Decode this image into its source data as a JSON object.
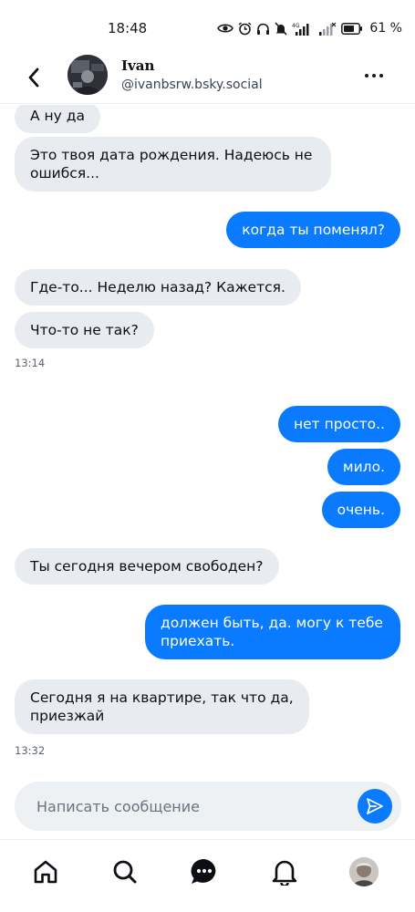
{
  "status_bar": {
    "time": "18:48",
    "network": "4G",
    "battery": "61 %"
  },
  "header": {
    "name": "Ivan",
    "handle": "@ivanbsrw.bsky.social"
  },
  "messages": [
    {
      "direction": "in",
      "text": "А ну да"
    },
    {
      "direction": "in",
      "text": "Это твоя дата рождения. Надеюсь не ошибся..."
    },
    {
      "direction": "out",
      "text": "когда ты поменял?"
    },
    {
      "direction": "in",
      "text": "Где-то... Неделю назад? Кажется."
    },
    {
      "direction": "in",
      "text": "Что-то не так?"
    },
    {
      "direction": "out",
      "text": "нет просто.."
    },
    {
      "direction": "out",
      "text": "мило."
    },
    {
      "direction": "out",
      "text": "очень."
    },
    {
      "direction": "in",
      "text": "Ты сегодня вечером свободен?"
    },
    {
      "direction": "out",
      "text": "должен быть, да. могу к тебе приехать."
    },
    {
      "direction": "in",
      "text": "Сегодня я на квартире, так что да, приезжай"
    }
  ],
  "timestamps": [
    "13:14",
    "13:32"
  ],
  "composer": {
    "placeholder": "Написать сообщение"
  },
  "colors": {
    "accent": "#0a7aff",
    "incoming_bubble": "#e8ecf0",
    "composer_bg": "#eef1f4"
  },
  "icons": {
    "nav": [
      "home-icon",
      "search-icon",
      "chat-icon",
      "bell-icon",
      "profile-avatar"
    ]
  }
}
